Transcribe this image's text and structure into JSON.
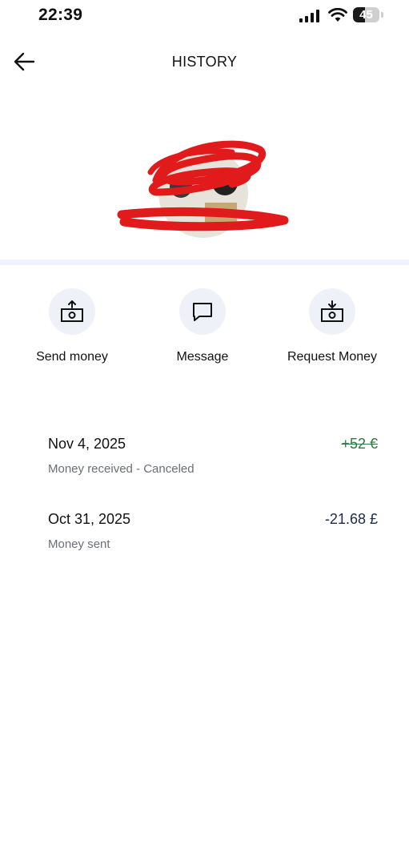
{
  "status_bar": {
    "time": "22:39",
    "battery_level": 45,
    "battery_text": "45"
  },
  "header": {
    "title": "HISTORY"
  },
  "colors": {
    "redaction": "#e11b1b",
    "divider": "#eef2fb",
    "action_circle": "#eef1f7",
    "amount_received": "#2d7a3c",
    "amount_sent": "#1b2a4a",
    "secondary_text": "#6b6f76"
  },
  "actions": [
    {
      "label": "Send money",
      "icon": "send-money-icon"
    },
    {
      "label": "Message",
      "icon": "message-icon"
    },
    {
      "label": "Request Money",
      "icon": "request-money-icon"
    }
  ],
  "transactions": [
    {
      "date": "Nov 4, 2025",
      "description": "Money received - Canceled",
      "amount": "+52 €",
      "status": "canceled"
    },
    {
      "date": "Oct 31, 2025",
      "description": "Money sent",
      "amount": "-21.68 £",
      "status": "sent"
    }
  ]
}
